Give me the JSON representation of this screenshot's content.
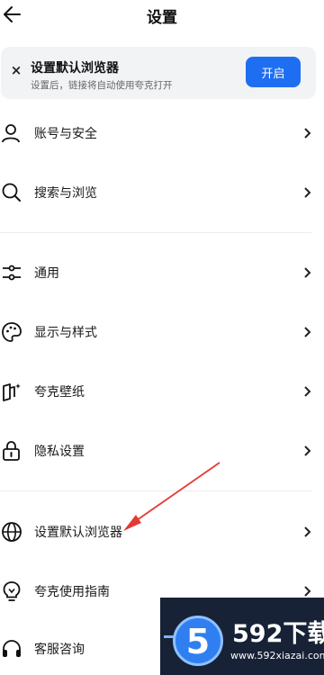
{
  "header": {
    "title": "设置",
    "back_icon": "arrow-left-icon"
  },
  "banner": {
    "title": "设置默认浏览器",
    "subtitle": "设置后，链接将自动使用夸克打开",
    "button_label": "开启",
    "button_color": "#1e6ef2",
    "close_icon": "close-icon"
  },
  "menu": {
    "items": [
      {
        "label": "账号与安全",
        "icon": "user-icon"
      },
      {
        "label": "搜索与浏览",
        "icon": "search-icon"
      },
      {
        "label": "通用",
        "icon": "sliders-icon"
      },
      {
        "label": "显示与样式",
        "icon": "palette-icon"
      },
      {
        "label": "夸克壁纸",
        "icon": "wallpaper-icon"
      },
      {
        "label": "隐私设置",
        "icon": "lock-icon"
      },
      {
        "label": "设置默认浏览器",
        "icon": "globe-icon"
      },
      {
        "label": "夸克使用指南",
        "icon": "lightbulb-icon"
      },
      {
        "label": "客服咨询",
        "icon": "headset-icon"
      }
    ]
  },
  "annotation": {
    "arrow_color": "#e53935"
  },
  "watermark": {
    "digit": "5",
    "brand": "592下载",
    "url": "www.592xiazai.com"
  }
}
